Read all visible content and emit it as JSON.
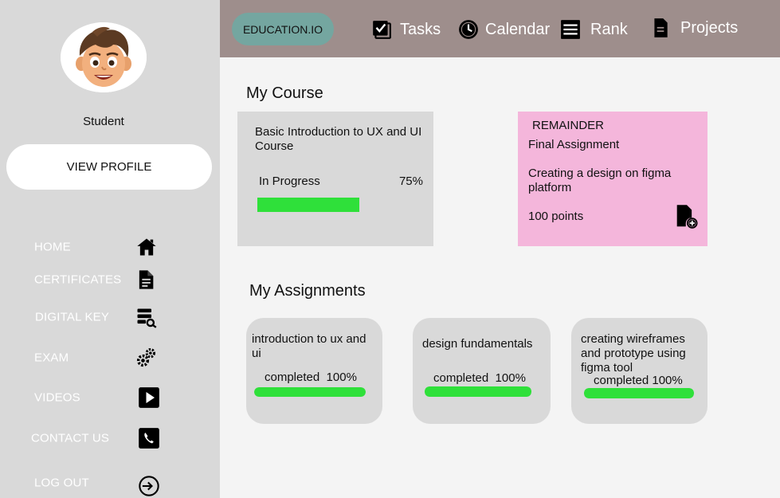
{
  "sidebar": {
    "user_role": "Student",
    "view_profile_label": "VIEW PROFILE",
    "items": [
      {
        "label": "HOME",
        "icon": "home-icon"
      },
      {
        "label": "CERTIFICATES",
        "icon": "document-icon"
      },
      {
        "label": "DIGITAL KEY",
        "icon": "key-document-icon"
      },
      {
        "label": "EXAM",
        "icon": "gears-icon"
      },
      {
        "label": "VIDEOS",
        "icon": "play-icon"
      },
      {
        "label": "CONTACT US",
        "icon": "phone-icon"
      },
      {
        "label": "LOG OUT",
        "icon": "logout-icon"
      }
    ]
  },
  "topbar": {
    "brand": "EDUCATION.IO",
    "items": [
      {
        "label": "Tasks",
        "icon": "checkbox-icon"
      },
      {
        "label": "Calendar",
        "icon": "clock-icon"
      },
      {
        "label": "Rank",
        "icon": "list-icon"
      },
      {
        "label": "Projects",
        "icon": "file-icon"
      }
    ]
  },
  "main": {
    "course_section_title": "My Course",
    "course": {
      "title": "Basic Introduction to UX and UI Course",
      "status": "In Progress",
      "percent": "75%",
      "progress": 0.75
    },
    "reminder": {
      "heading": "REMAINDER",
      "title": "Final Assignment",
      "description": "Creating a design on figma platform",
      "points": "100 points",
      "icon": "file-add-icon"
    },
    "assignments_section_title": "My Assignments",
    "assignments": [
      {
        "title": "introduction to ux and ui",
        "status": "completed  100%",
        "progress": 1.0
      },
      {
        "title": "design fundamentals",
        "status": "completed  100%",
        "progress": 1.0
      },
      {
        "title": "creating wireframes and prototype using figma tool",
        "status": "completed 100%",
        "progress": 1.0
      }
    ]
  },
  "colors": {
    "sidebar_bg": "#d9d9d9",
    "topbar_bg": "#9e8e8c",
    "brand_pill": "#74a6a0",
    "progress_green": "#2fe03a",
    "reminder_bg": "#f4b6db"
  }
}
